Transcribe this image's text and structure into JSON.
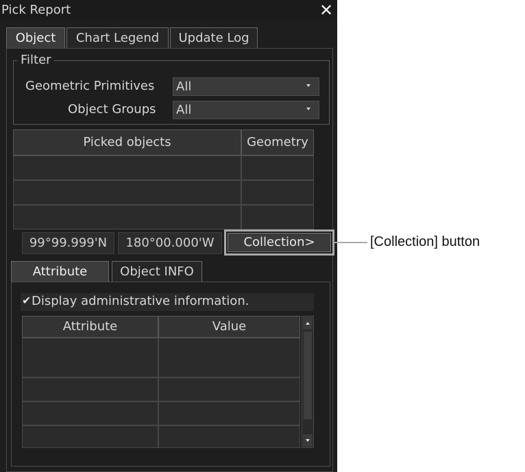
{
  "window": {
    "title": "Pick Report",
    "close_glyph": "✕"
  },
  "tabs": [
    {
      "label": "Object",
      "active": true
    },
    {
      "label": "Chart Legend",
      "active": false
    },
    {
      "label": "Update Log",
      "active": false
    }
  ],
  "filter": {
    "legend": "Filter",
    "geometric_primitives": {
      "label": "Geometric Primitives",
      "value": "All"
    },
    "object_groups": {
      "label": "Object Groups",
      "value": "All"
    }
  },
  "picked_table": {
    "headers": [
      "Picked objects",
      "Geometry"
    ],
    "rows": [
      [
        "",
        ""
      ],
      [
        "",
        ""
      ],
      [
        "",
        ""
      ]
    ]
  },
  "position": {
    "lat": "99°99.999'N",
    "lon": "180°00.000'W"
  },
  "collection_button": "Collection>",
  "sub_tabs": [
    {
      "label": "Attribute",
      "active": true
    },
    {
      "label": "Object INFO",
      "active": false
    }
  ],
  "admin_checkbox": {
    "checked": true,
    "label": "Display administrative information."
  },
  "attribute_table": {
    "headers": [
      "Attribute",
      "Value"
    ],
    "rows": [
      [
        "",
        ""
      ],
      [
        "",
        ""
      ],
      [
        "",
        ""
      ],
      [
        "",
        ""
      ],
      [
        "",
        ""
      ]
    ]
  },
  "annotation": {
    "text": "[Collection] button"
  },
  "colors": {
    "window_bg": "#1e1e1e",
    "highlight": "#a8a8a8"
  },
  "icons": {
    "close": "close-icon",
    "dropdown": "chevron-down-icon",
    "check": "check-icon",
    "scroll_up": "scroll-up-icon",
    "scroll_down": "scroll-down-icon"
  }
}
